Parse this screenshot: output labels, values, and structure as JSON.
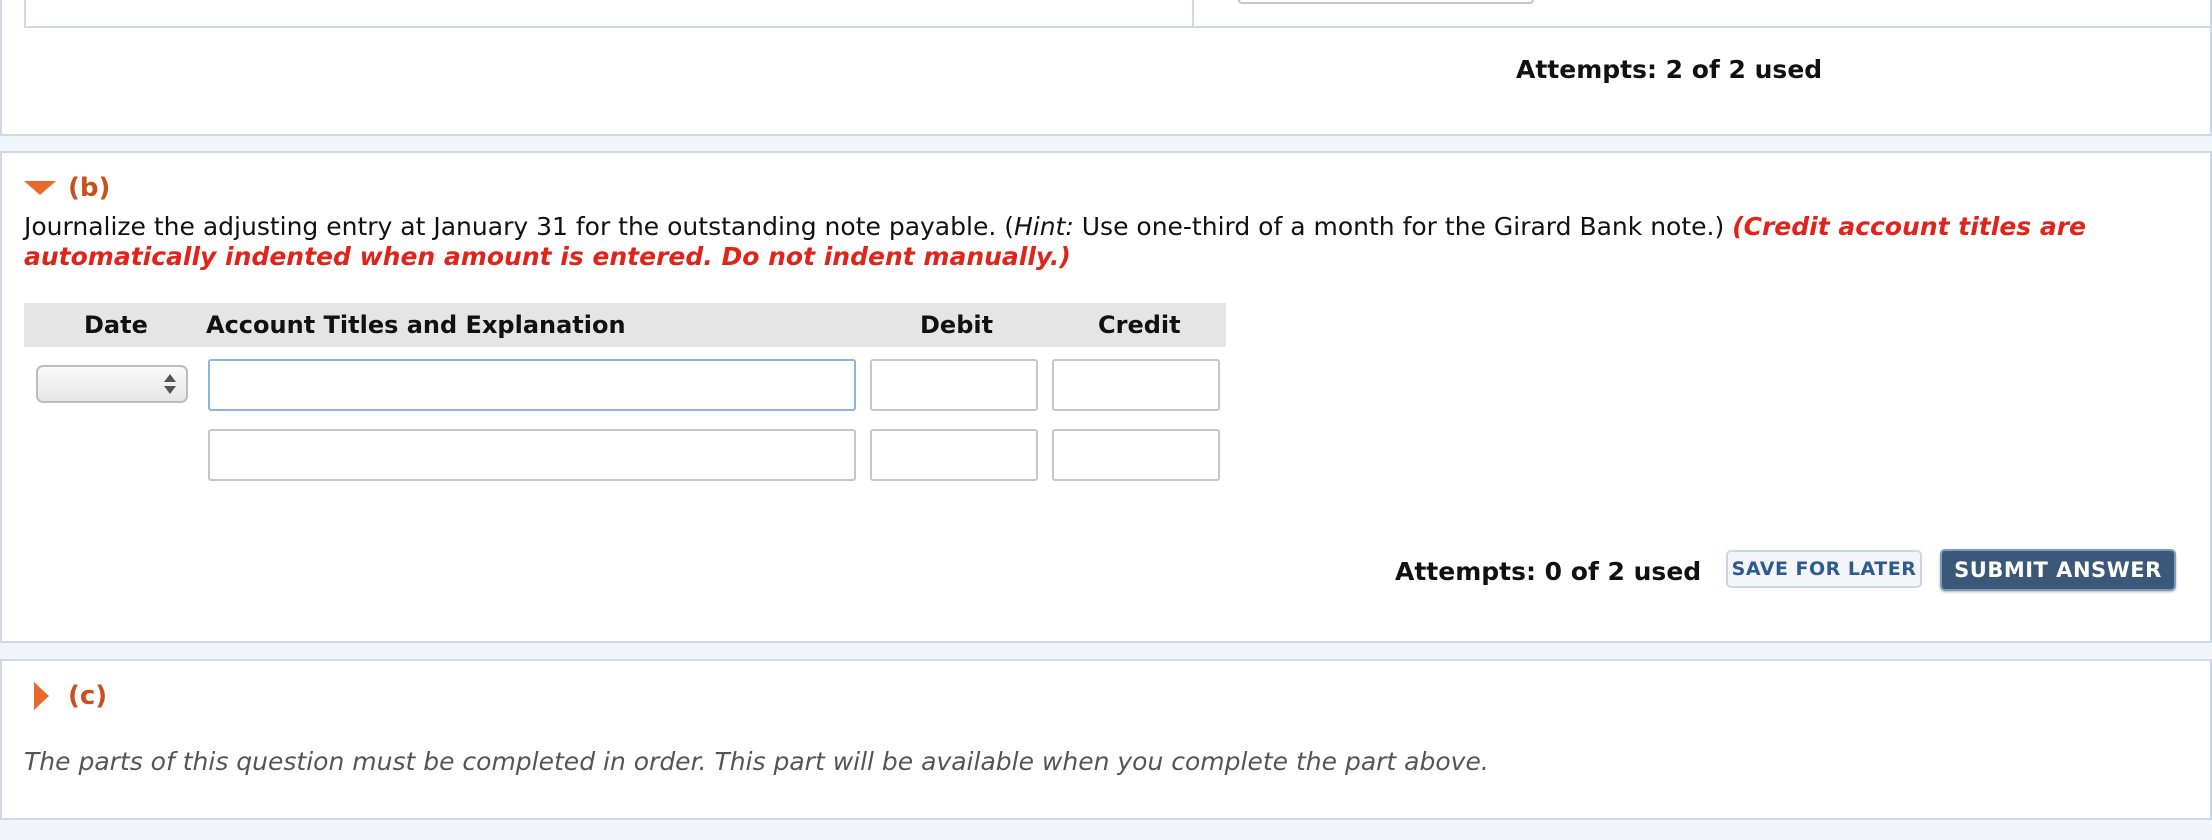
{
  "part_a": {
    "attempts": "Attempts: 2 of 2 used"
  },
  "part_b": {
    "label": "(b)",
    "question_main": "Journalize the adjusting entry at January 31 for the outstanding note payable. (",
    "hint_label": "Hint:",
    "hint_text": " Use one-third of a month for the Girard Bank note.) ",
    "note": "(Credit account titles are automatically indented when amount is entered. Do not indent manually.)",
    "table": {
      "headers": {
        "date": "Date",
        "account": "Account Titles and Explanation",
        "debit": "Debit",
        "credit": "Credit"
      },
      "rows": [
        {
          "date": "",
          "account": "",
          "debit": "",
          "credit": ""
        },
        {
          "account": "",
          "debit": "",
          "credit": ""
        }
      ]
    },
    "attempts": "Attempts: 0 of 2 used",
    "save_label": "SAVE FOR LATER",
    "submit_label": "SUBMIT ANSWER"
  },
  "part_c": {
    "label": "(c)",
    "message": "The parts of this question must be completed in order. This part will be available when you complete the part above."
  },
  "colors": {
    "accent_orange": "#e8692b",
    "part_label": "#c9501c",
    "note_red": "#e2231a",
    "submit_bg": "#3c5879",
    "save_text": "#2f5a8e"
  },
  "icons": {
    "expanded": "triangle-down-icon",
    "collapsed": "triangle-right-icon",
    "select": "select-arrows-icon"
  }
}
